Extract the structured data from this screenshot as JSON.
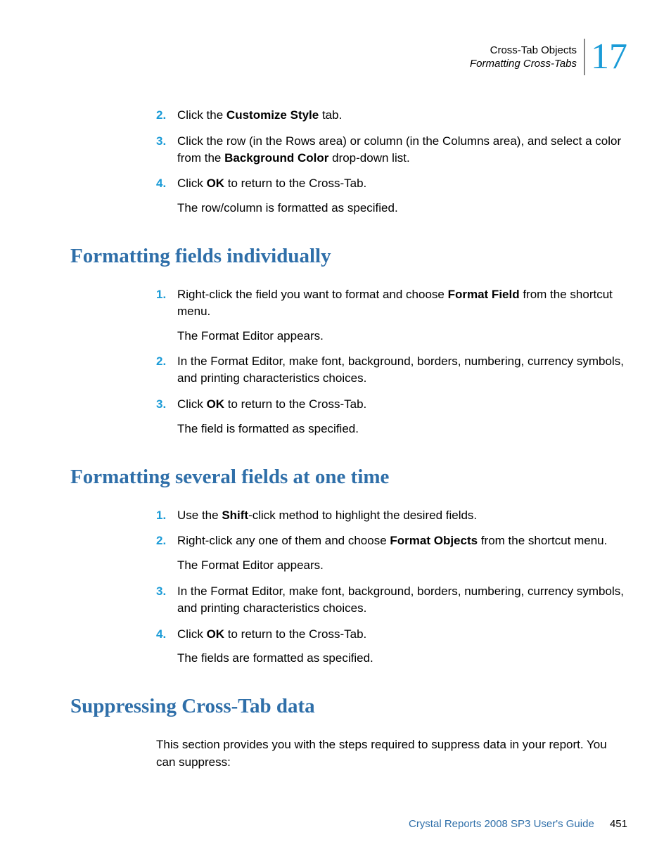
{
  "header": {
    "line1": "Cross-Tab Objects",
    "line2": "Formatting Cross-Tabs",
    "chapter": "17"
  },
  "section0": {
    "steps": {
      "s2": {
        "num": "2.",
        "pre": "Click the ",
        "bold": "Customize Style",
        "post": " tab."
      },
      "s3": {
        "num": "3.",
        "pre": "Click the row (in the Rows area) or column (in the Columns area), and select a color from the ",
        "bold": "Background Color",
        "post": " drop-down list."
      },
      "s4": {
        "num": "4.",
        "pre": "Click ",
        "bold": "OK",
        "post": " to return to the Cross-Tab.",
        "follow": "The row/column is formatted as specified."
      }
    }
  },
  "section1": {
    "heading": "Formatting fields individually",
    "steps": {
      "s1": {
        "num": "1.",
        "pre": "Right-click the field you want to format and choose ",
        "bold": "Format Field",
        "post": " from the shortcut menu.",
        "follow": "The Format Editor appears."
      },
      "s2": {
        "num": "2.",
        "text": "In the Format Editor, make font, background, borders, numbering, currency symbols, and printing characteristics choices."
      },
      "s3": {
        "num": "3.",
        "pre": "Click ",
        "bold": "OK",
        "post": " to return to the Cross-Tab.",
        "follow": "The field is formatted as specified."
      }
    }
  },
  "section2": {
    "heading": "Formatting several fields at one time",
    "steps": {
      "s1": {
        "num": "1.",
        "pre": "Use the ",
        "bold": "Shift",
        "post": "-click method to highlight the desired fields."
      },
      "s2": {
        "num": "2.",
        "pre": "Right-click any one of them and choose ",
        "bold": "Format Objects",
        "post": " from the shortcut menu.",
        "follow": "The Format Editor appears."
      },
      "s3": {
        "num": "3.",
        "text": "In the Format Editor, make font, background, borders, numbering, currency symbols, and printing characteristics choices."
      },
      "s4": {
        "num": "4.",
        "pre": "Click ",
        "bold": "OK",
        "post": " to return to the Cross-Tab.",
        "follow": "The fields are formatted as specified."
      }
    }
  },
  "section3": {
    "heading": "Suppressing Cross-Tab data",
    "body": "This section provides you with the steps required to suppress data in your report. You can suppress:"
  },
  "footer": {
    "title": "Crystal Reports 2008 SP3 User's Guide",
    "page": "451"
  }
}
